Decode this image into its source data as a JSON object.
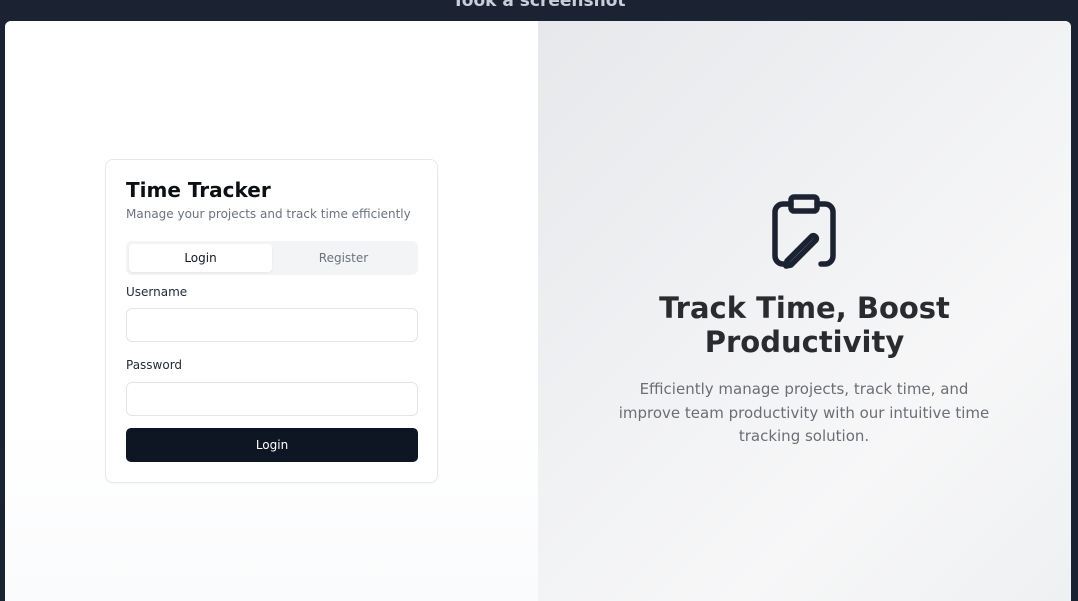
{
  "caption": "Took a screenshot",
  "login_card": {
    "title": "Time Tracker",
    "subtitle": "Manage your projects and track time efficiently",
    "tabs": [
      {
        "label": "Login",
        "active": true
      },
      {
        "label": "Register",
        "active": false
      }
    ],
    "username": {
      "label": "Username",
      "value": "",
      "placeholder": ""
    },
    "password": {
      "label": "Password",
      "value": "",
      "placeholder": ""
    },
    "submit_label": "Login"
  },
  "hero": {
    "icon": "clipboard-edit-icon",
    "title_line1": "Track Time, Boost",
    "title_line2": "Productivity",
    "text": "Efficiently manage projects, track time, and improve team productivity with our intuitive time tracking solution."
  },
  "colors": {
    "frame": "#1b2232",
    "primary_button": "#0f1623",
    "hero_background": "#eeeff1",
    "icon_stroke": "#1b2232"
  }
}
